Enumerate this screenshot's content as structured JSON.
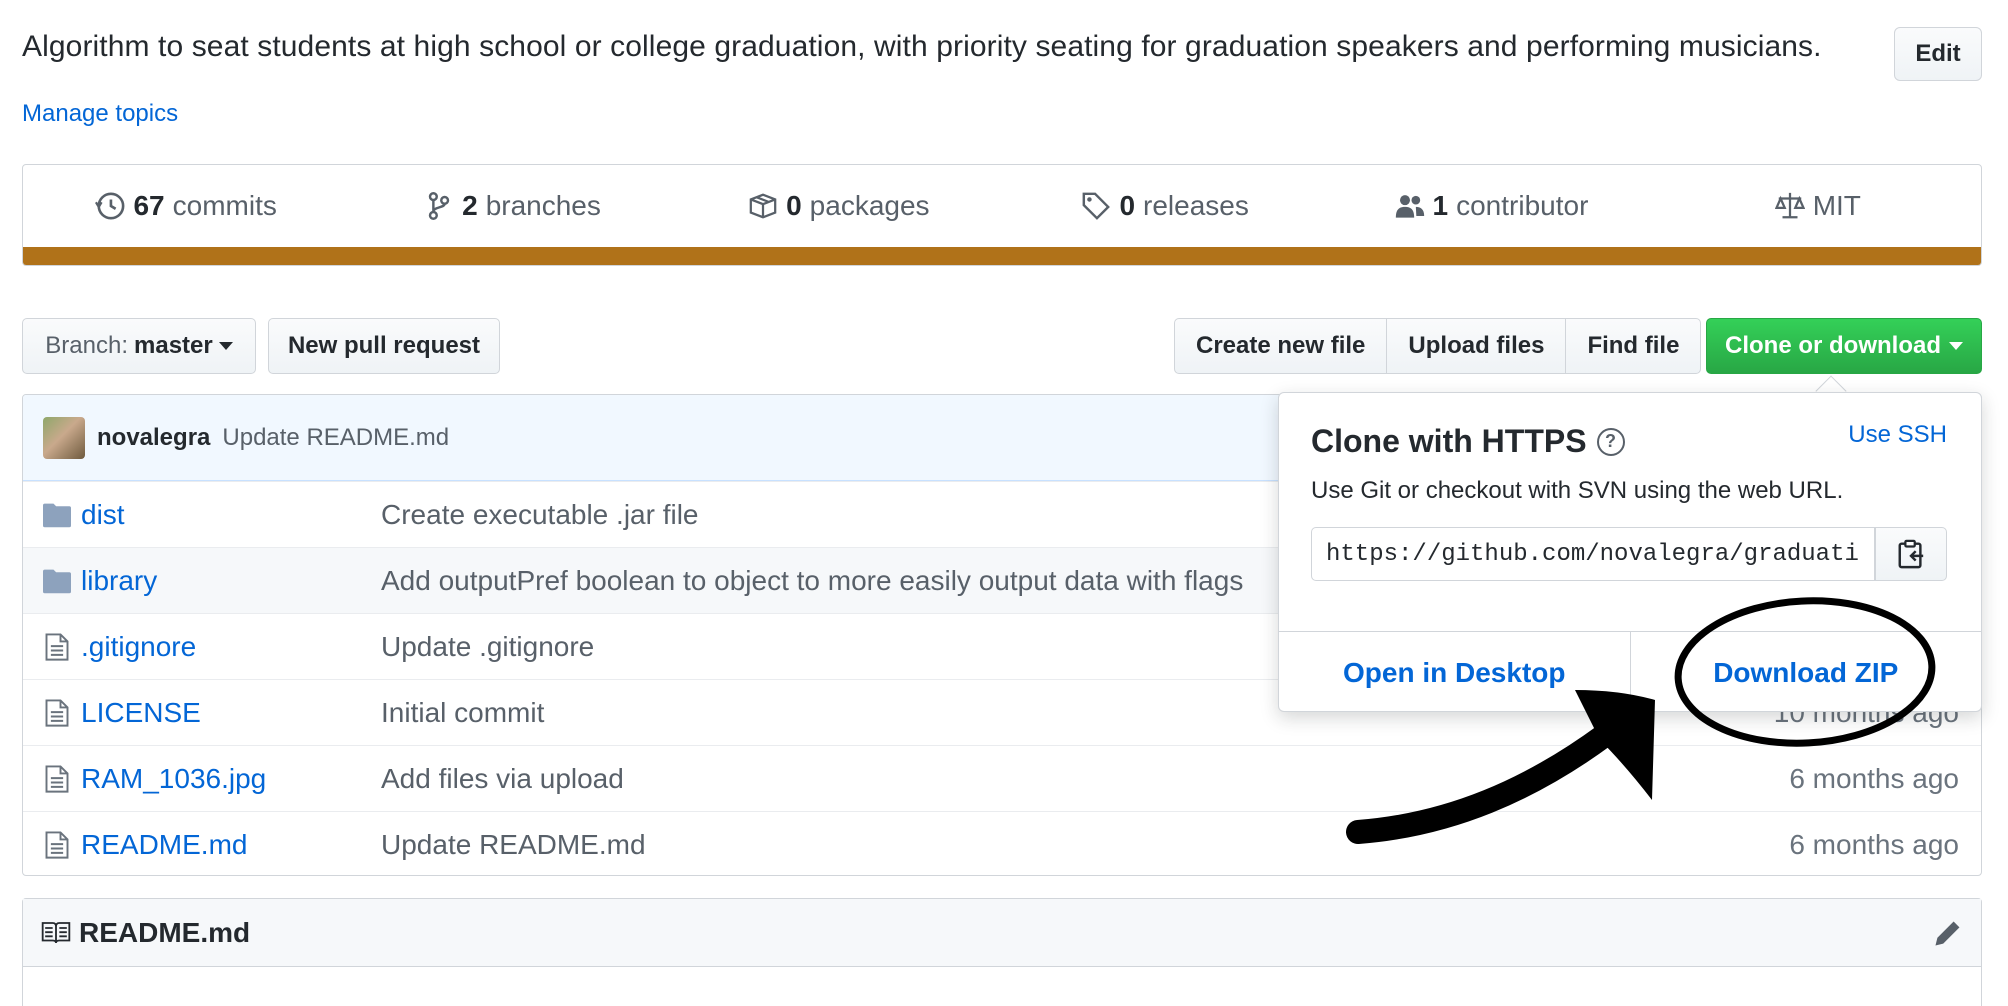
{
  "repo": {
    "description": "Algorithm to seat students at high school or college graduation, with priority seating for graduation speakers and performing musicians.",
    "edit_label": "Edit",
    "manage_topics": "Manage topics"
  },
  "stats": {
    "commits_count": "67",
    "commits_label": "commits",
    "branches_count": "2",
    "branches_label": "branches",
    "packages_count": "0",
    "packages_label": "packages",
    "releases_count": "0",
    "releases_label": "releases",
    "contributors_count": "1",
    "contributors_label": "contributor",
    "license": "MIT",
    "language_color": "#b07219"
  },
  "toolbar": {
    "branch_prefix": "Branch:",
    "branch_name": "master",
    "new_pr": "New pull request",
    "create_file": "Create new file",
    "upload_files": "Upload files",
    "find_file": "Find file",
    "clone_download": "Clone or download"
  },
  "latest_commit": {
    "author": "novalegra",
    "message": "Update README.md"
  },
  "files": [
    {
      "type": "dir",
      "name": "dist",
      "message": "Create executable .jar file",
      "age": ""
    },
    {
      "type": "dir",
      "name": "library",
      "message": "Add outputPref boolean to object to more easily output data with flags",
      "age": ""
    },
    {
      "type": "file",
      "name": ".gitignore",
      "message": "Update .gitignore",
      "age": ""
    },
    {
      "type": "file",
      "name": "LICENSE",
      "message": "Initial commit",
      "age": "10 months ago"
    },
    {
      "type": "file",
      "name": "RAM_1036.jpg",
      "message": "Add files via upload",
      "age": "6 months ago"
    },
    {
      "type": "file",
      "name": "README.md",
      "message": "Update README.md",
      "age": "6 months ago"
    }
  ],
  "clone": {
    "title": "Clone with HTTPS",
    "help": "?",
    "use_ssh": "Use SSH",
    "subtitle": "Use Git or checkout with SVN using the web URL.",
    "url": "https://github.com/novalegra/graduati",
    "open_desktop": "Open in Desktop",
    "download_zip": "Download ZIP"
  },
  "readme": {
    "title": "README.md"
  }
}
